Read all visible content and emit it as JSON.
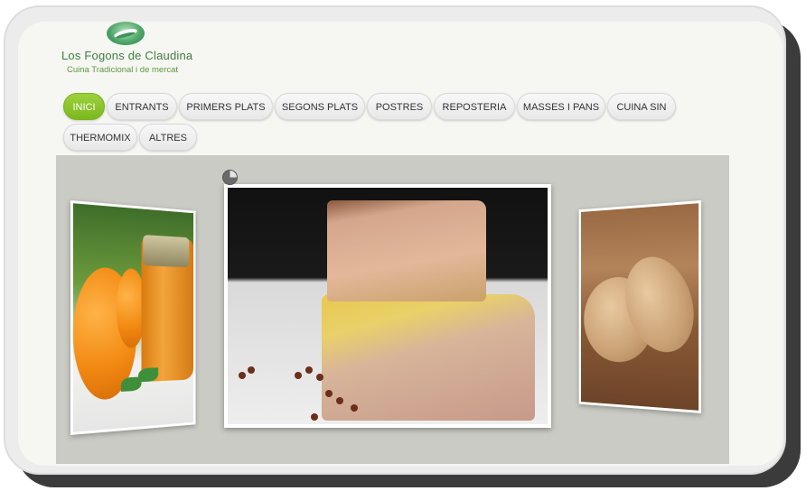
{
  "site": {
    "title": "Los Fogons de Claudina",
    "subtitle": "Cuina Tradicional i de mercat",
    "logo_icon": "leaf-logo-icon",
    "brand_color": "#3f7f3f"
  },
  "nav": {
    "active_color": "#8cc42a",
    "items": [
      {
        "label": "INICI",
        "active": true
      },
      {
        "label": "ENTRANTS",
        "active": false
      },
      {
        "label": "PRIMERS PLATS",
        "active": false
      },
      {
        "label": "SEGONS PLATS",
        "active": false
      },
      {
        "label": "POSTRES",
        "active": false
      },
      {
        "label": "REPOSTERIA",
        "active": false
      },
      {
        "label": "MASSES I PANS",
        "active": false
      },
      {
        "label": "CUINA SIN",
        "active": false
      },
      {
        "label": "THERMOMIX",
        "active": false
      },
      {
        "label": "ALTRES",
        "active": false
      }
    ]
  },
  "slider": {
    "loader_icon": "loading-pie-icon",
    "slides": [
      {
        "position": "left",
        "subject": "orange jam jar with oranges"
      },
      {
        "position": "center",
        "subject": "foie gras terrine with pink peppercorns"
      },
      {
        "position": "right",
        "subject": "pita breads on wooden board"
      }
    ]
  }
}
